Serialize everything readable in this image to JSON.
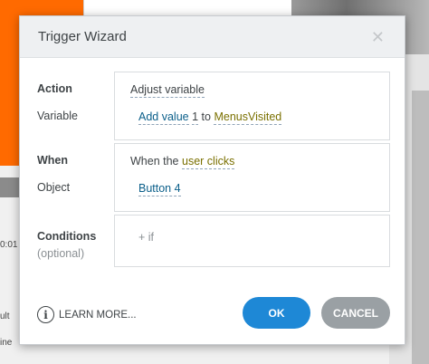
{
  "background": {
    "text1": "0:01",
    "text2": "ult",
    "text3": "ine"
  },
  "dialog": {
    "title": "Trigger Wizard",
    "action": {
      "label": "Action",
      "value": "Adjust variable",
      "variable_label": "Variable",
      "op_text": "Add value",
      "op_value": "1",
      "to_text": "to",
      "variable_name": "MenusVisited"
    },
    "when": {
      "label": "When",
      "prefix": "When the",
      "event": "user clicks",
      "object_label": "Object",
      "object": "Button 4"
    },
    "conditions": {
      "label": "Conditions",
      "optional": "(optional)",
      "add": "+ if"
    },
    "footer": {
      "learn_more": "LEARN MORE...",
      "ok": "OK",
      "cancel": "CANCEL"
    }
  }
}
